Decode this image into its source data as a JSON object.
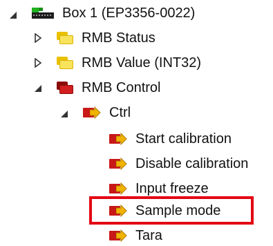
{
  "tree": {
    "box": {
      "label": "Box 1 (EP3356-0022)",
      "icon": "terminal-box-icon",
      "state": "expanded"
    },
    "rmb_status": {
      "label": "RMB Status",
      "icon": "yellow-folder-icon",
      "state": "collapsed"
    },
    "rmb_value": {
      "label": "RMB Value (INT32)",
      "icon": "yellow-folder-icon",
      "state": "collapsed"
    },
    "rmb_control": {
      "label": "RMB Control",
      "icon": "red-folder-icon",
      "state": "expanded"
    },
    "ctrl": {
      "label": "Ctrl",
      "icon": "output-variable-icon",
      "state": "expanded"
    },
    "items": [
      {
        "label": "Start calibration",
        "icon": "output-variable-icon"
      },
      {
        "label": "Disable calibration",
        "icon": "output-variable-icon"
      },
      {
        "label": "Input freeze",
        "icon": "output-variable-icon"
      },
      {
        "label": "Sample mode",
        "icon": "output-variable-icon",
        "highlighted": true
      },
      {
        "label": "Tara",
        "icon": "output-variable-icon"
      }
    ]
  },
  "colors": {
    "highlight": "#e30613",
    "output_var": "#c81818",
    "arrow": "#f0b400",
    "yellow_folder": "#f7e35c",
    "red_folder": "#d21e1e",
    "device_green": "#1fb21f"
  }
}
